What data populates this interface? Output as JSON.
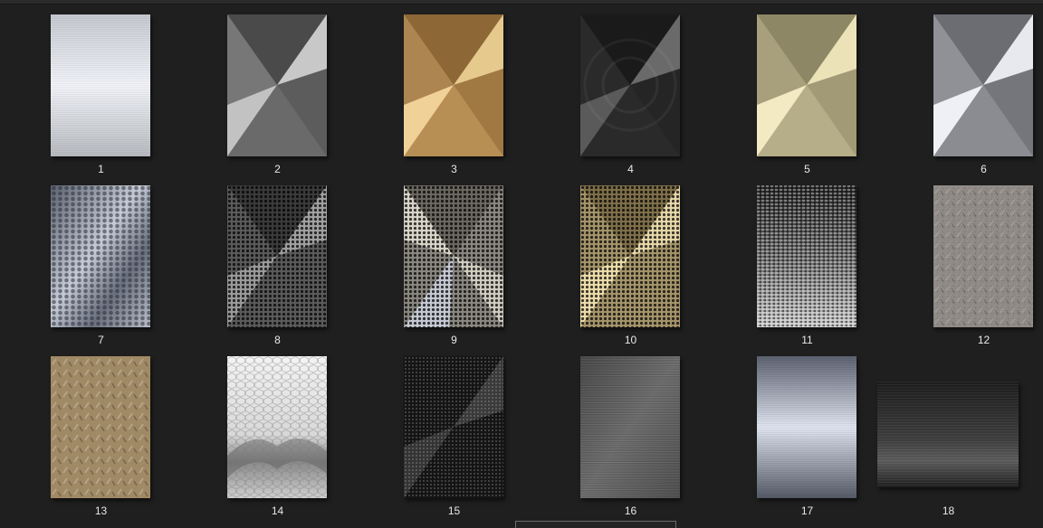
{
  "gallery": {
    "items": [
      {
        "label": "1",
        "texture": "brushed-silver-horizontal"
      },
      {
        "label": "2",
        "texture": "radial-dark-steel"
      },
      {
        "label": "3",
        "texture": "radial-gold"
      },
      {
        "label": "4",
        "texture": "radial-black-steel"
      },
      {
        "label": "5",
        "texture": "radial-champagne"
      },
      {
        "label": "6",
        "texture": "radial-silver"
      },
      {
        "label": "7",
        "texture": "perforated-silver"
      },
      {
        "label": "8",
        "texture": "perforated-dark"
      },
      {
        "label": "9",
        "texture": "perforated-silver-radial"
      },
      {
        "label": "10",
        "texture": "perforated-gold"
      },
      {
        "label": "11",
        "texture": "woven-mesh"
      },
      {
        "label": "12",
        "texture": "diamond-plate-gray"
      },
      {
        "label": "13",
        "texture": "diamond-plate-bronze"
      },
      {
        "label": "14",
        "texture": "hexagon-white"
      },
      {
        "label": "15",
        "texture": "perforated-black"
      },
      {
        "label": "16",
        "texture": "brushed-dark-gray"
      },
      {
        "label": "17",
        "texture": "brushed-blue-steel"
      },
      {
        "label": "18",
        "texture": "brushed-black-landscape"
      }
    ]
  },
  "colors": {
    "background": "#1f1f1f",
    "label_text": "#e8e8e8"
  }
}
